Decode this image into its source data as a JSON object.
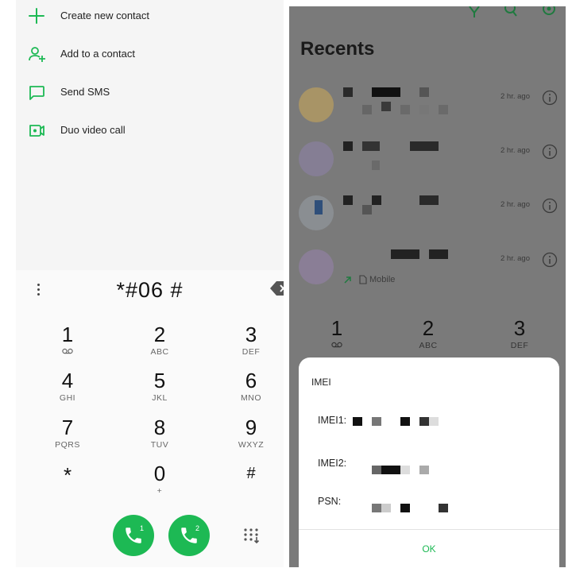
{
  "left_panel": {
    "menu": [
      {
        "label": "Create new contact",
        "icon": "add-icon"
      },
      {
        "label": "Add to a contact",
        "icon": "add-person-icon"
      },
      {
        "label": "Send SMS",
        "icon": "message-icon"
      },
      {
        "label": "Duo video call",
        "icon": "video-call-icon"
      }
    ],
    "dialer": {
      "number": "*#06 #",
      "keys": [
        {
          "digit": "1",
          "letters": ""
        },
        {
          "digit": "2",
          "letters": "ABC"
        },
        {
          "digit": "3",
          "letters": "DEF"
        },
        {
          "digit": "4",
          "letters": "GHI"
        },
        {
          "digit": "5",
          "letters": "JKL"
        },
        {
          "digit": "6",
          "letters": "MNO"
        },
        {
          "digit": "7",
          "letters": "PQRS"
        },
        {
          "digit": "8",
          "letters": "TUV"
        },
        {
          "digit": "9",
          "letters": "WXYZ"
        },
        {
          "digit": "*",
          "letters": ""
        },
        {
          "digit": "0",
          "letters": "+"
        },
        {
          "digit": "#",
          "letters": ""
        }
      ],
      "call_buttons": [
        {
          "sim": "1"
        },
        {
          "sim": "2"
        }
      ]
    }
  },
  "right_panel": {
    "title": "Recents",
    "recents": [
      {
        "time": "2 hr. ago",
        "subtitle": ""
      },
      {
        "time": "2 hr. ago",
        "subtitle": ""
      },
      {
        "time": "2 hr. ago",
        "subtitle": ""
      },
      {
        "time": "2 hr. ago",
        "subtitle": "Mobile"
      }
    ],
    "keys": [
      {
        "digit": "1",
        "letters": ""
      },
      {
        "digit": "2",
        "letters": "ABC"
      },
      {
        "digit": "3",
        "letters": "DEF"
      }
    ],
    "dialog": {
      "title": "IMEI",
      "imei1_label": "IMEI1:",
      "imei2_label": "IMEI2:",
      "psn_label": "PSN:",
      "ok_label": "OK"
    }
  },
  "colors": {
    "accent": "#1db954",
    "panel_bg": "#f5f5f5",
    "overlay": "#7a7a7a"
  }
}
